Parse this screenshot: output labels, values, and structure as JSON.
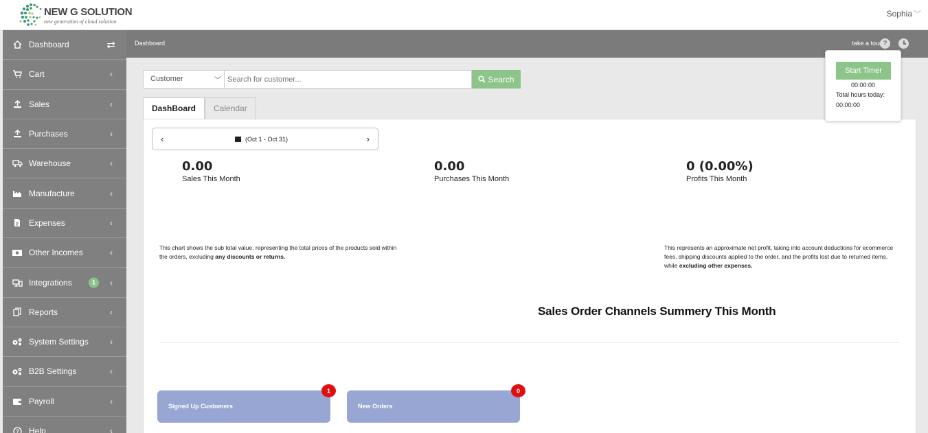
{
  "brand": {
    "title": "NEW G SOLUTION",
    "subtitle": "new generation of cloud solution"
  },
  "user": {
    "name": "Sophia"
  },
  "sidebar": {
    "items": [
      {
        "label": "Dashboard",
        "icon": "home-icon"
      },
      {
        "label": "Cart",
        "icon": "cart-icon"
      },
      {
        "label": "Sales",
        "icon": "upload-icon"
      },
      {
        "label": "Purchases",
        "icon": "upload-icon"
      },
      {
        "label": "Warehouse",
        "icon": "truck-icon"
      },
      {
        "label": "Manufacture",
        "icon": "factory-icon"
      },
      {
        "label": "Expenses",
        "icon": "file-icon"
      },
      {
        "label": "Other Incomes",
        "icon": "money-icon"
      },
      {
        "label": "Integrations",
        "icon": "integration-icon",
        "badge": "1"
      },
      {
        "label": "Reports",
        "icon": "copy-icon"
      },
      {
        "label": "System Settings",
        "icon": "gears-icon"
      },
      {
        "label": "B2B Settings",
        "icon": "gears-icon"
      },
      {
        "label": "Payroll",
        "icon": "wallet-icon"
      },
      {
        "label": "Help",
        "icon": "help-icon"
      }
    ]
  },
  "breadcrumb": {
    "current": "Dashboard",
    "tour_label": "take a tour"
  },
  "search": {
    "filter_value": "Customer",
    "placeholder": "Search for customer...",
    "button_label": "Search"
  },
  "tabs": [
    {
      "label": "DashBoard",
      "active": true
    },
    {
      "label": "Calendar",
      "active": false
    }
  ],
  "date_range": {
    "label": "(Oct 1 - Oct 31)"
  },
  "stats": [
    {
      "value": "0.00",
      "label": "Sales This Month"
    },
    {
      "value": "0.00",
      "label": "Purchases This Month"
    },
    {
      "value": "0 (0.00%)",
      "label": "Profits This Month"
    }
  ],
  "notes": {
    "sales_prefix": "This chart shows the sub total value, representing the total prices of the products sold within the orders, excluding ",
    "sales_bold": "any discounts or returns.",
    "profit_prefix": "This represents an approximate net profit, taking into account deductions for ecommerce fees, shipping discounts applied to the order, and the profits lost due to returned items, while ",
    "profit_bold": "excluding other expenses."
  },
  "channels_title": "Sales Order Channels Summery This Month",
  "cards": [
    {
      "label": "Signed Up Customers",
      "count": "1"
    },
    {
      "label": "New Orders",
      "count": "0"
    }
  ],
  "timer": {
    "button_label": "Start Timer",
    "elapsed": "00:00:00",
    "total_label": "Total hours today:",
    "total_value": "00:00:00"
  },
  "colors": {
    "sidebar": "#808080",
    "accent_green": "#8cc48a",
    "card": "#97a6d2",
    "badge_red": "#e10e0e"
  }
}
